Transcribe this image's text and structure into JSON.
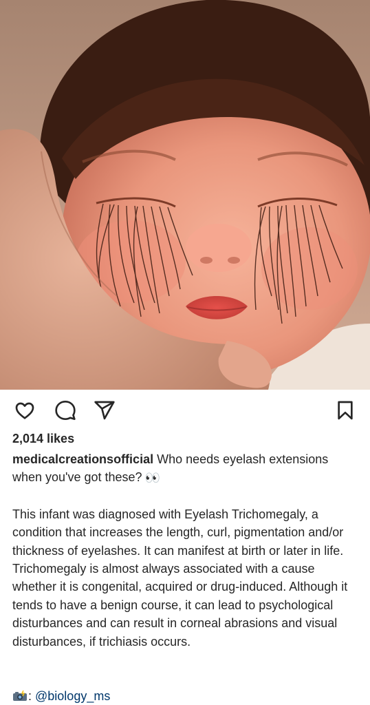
{
  "post": {
    "image": {
      "subject": "sleeping infant with very long eyelashes"
    },
    "actions": {
      "like_icon": "heart-outline-icon",
      "comment_icon": "comment-bubble-icon",
      "share_icon": "paper-plane-icon",
      "save_icon": "bookmark-outline-icon"
    },
    "likes_text": "2,014 likes",
    "caption": {
      "username": "medicalcreationsofficial",
      "headline": "Who needs eyelash extensions when you've got these?",
      "headline_emoji": "👀",
      "body": "This infant was diagnosed with Eyelash Trichomegaly, a condition that increases the length, curl, pigmentation and/or thickness of eyelashes. It can manifest at birth or later in life. Trichomegaly is almost always associated with a cause whether it is congenital, acquired or drug-induced. Although it tends to have a benign course, it can lead to psychological disturbances and can result in corneal abrasions and visual disturbances, if trichiasis occurs.",
      "credit_icon": "camera-flash-emoji",
      "credit_separator": ": ",
      "credit_handle": "@biology_ms"
    }
  },
  "colors": {
    "text": "#262626",
    "mention": "#00376b",
    "background": "#ffffff"
  }
}
